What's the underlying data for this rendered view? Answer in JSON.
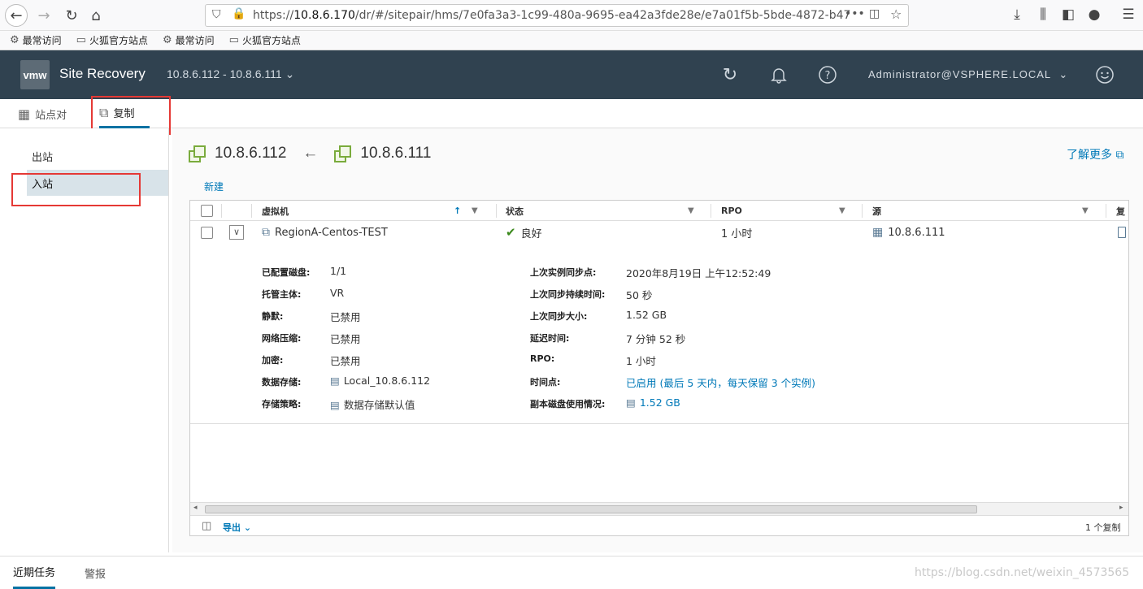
{
  "browser": {
    "url_prefix": "https://",
    "url_host": "10.8.6.170",
    "url_path": "/dr/#/sitepair/hms/7e0fa3a3-1c99-480a-9695-ea42a3fde28e/e7a01f5b-5bde-4872-b47",
    "bookmarks": [
      {
        "icon": "gear-icon",
        "label": "最常访问"
      },
      {
        "icon": "folder-icon",
        "label": "火狐官方站点"
      },
      {
        "icon": "gear-icon",
        "label": "最常访问"
      },
      {
        "icon": "folder-icon",
        "label": "火狐官方站点"
      }
    ]
  },
  "header": {
    "logo_text": "vmw",
    "title": "Site Recovery",
    "site_pair": "10.8.6.112 - 10.8.6.111",
    "user": "Administrator@VSPHERE.LOCAL"
  },
  "subtabs": {
    "site_pair": "站点对",
    "replication": "复制"
  },
  "sidebar": {
    "outgoing": "出站",
    "incoming": "入站"
  },
  "main": {
    "local_site": "10.8.6.112",
    "remote_site": "10.8.6.111",
    "arrow": "←",
    "learn_more": "了解更多",
    "new_label": "新建"
  },
  "grid": {
    "columns": {
      "vm": "虚拟机",
      "status": "状态",
      "rpo": "RPO",
      "source": "源",
      "truncated": "复"
    },
    "row": {
      "vm": "RegionA-Centos-TEST",
      "status": "良好",
      "rpo": "1 小时",
      "source": "10.8.6.111"
    },
    "details_left": [
      {
        "label": "已配置磁盘:",
        "value": "1/1"
      },
      {
        "label": "托管主体:",
        "value": "VR"
      },
      {
        "label": "静默:",
        "value": "已禁用"
      },
      {
        "label": "网络压缩:",
        "value": "已禁用"
      },
      {
        "label": "加密:",
        "value": "已禁用"
      },
      {
        "label": "数据存储:",
        "value": "Local_10.8.6.112"
      },
      {
        "label": "存储策略:",
        "value": "数据存储默认值"
      }
    ],
    "details_right": [
      {
        "label": "上次实例同步点:",
        "value": "2020年8月19日 上午12:52:49"
      },
      {
        "label": "上次同步持续时间:",
        "value": "50 秒"
      },
      {
        "label": "上次同步大小:",
        "value": "1.52 GB"
      },
      {
        "label": "延迟时间:",
        "value": "7 分钟 52 秒"
      },
      {
        "label": "RPO:",
        "value": "1 小时"
      },
      {
        "label": "时间点:",
        "value": "已启用 (最后 5 天内，每天保留 3 个实例)"
      },
      {
        "label": "副本磁盘使用情况:",
        "value": "1.52 GB"
      }
    ],
    "export_label": "导出",
    "count_label": "1 个复制"
  },
  "bottom": {
    "recent_tasks": "近期任务",
    "alarms": "警报",
    "watermark": "https://blog.csdn.net/weixin_4573565"
  }
}
